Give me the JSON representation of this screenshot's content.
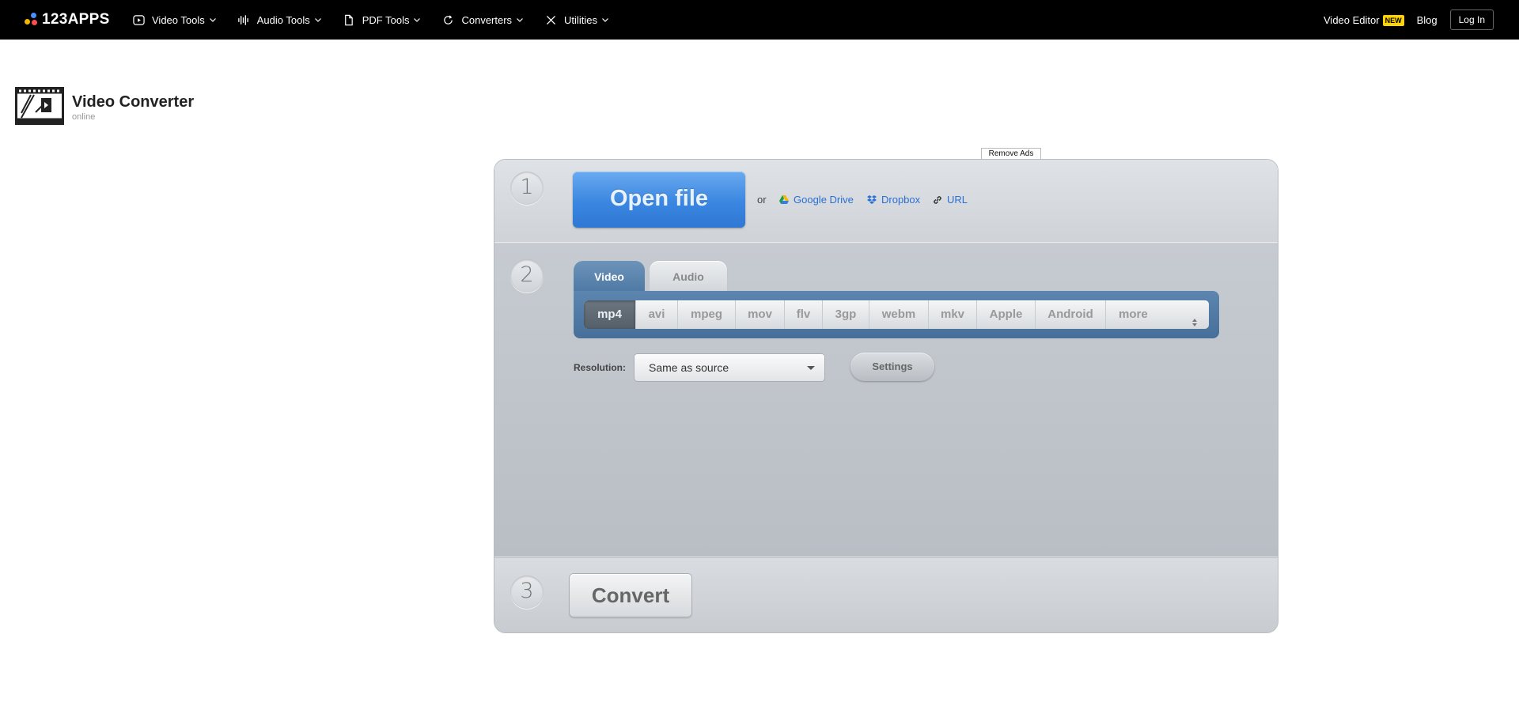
{
  "navbar": {
    "logo_text": "123APPS",
    "menu": [
      {
        "label": "Video Tools",
        "icon": "play-circle-icon"
      },
      {
        "label": "Audio Tools",
        "icon": "waveform-icon"
      },
      {
        "label": "PDF Tools",
        "icon": "document-icon"
      },
      {
        "label": "Converters",
        "icon": "refresh-icon"
      },
      {
        "label": "Utilities",
        "icon": "tools-icon"
      }
    ],
    "video_editor_label": "Video Editor",
    "new_badge": "NEW",
    "blog_label": "Blog",
    "login_label": "Log In"
  },
  "app": {
    "title": "Video Converter",
    "subtitle": "online",
    "remove_ads_label": "Remove Ads"
  },
  "step1": {
    "number": "1",
    "open_file_label": "Open file",
    "or_label": "or",
    "sources": [
      {
        "label": "Google Drive",
        "icon": "google-drive-icon"
      },
      {
        "label": "Dropbox",
        "icon": "dropbox-icon"
      },
      {
        "label": "URL",
        "icon": "link-icon"
      }
    ]
  },
  "step2": {
    "number": "2",
    "tabs": [
      {
        "label": "Video",
        "active": true
      },
      {
        "label": "Audio",
        "active": false
      }
    ],
    "formats": [
      "mp4",
      "avi",
      "mpeg",
      "mov",
      "flv",
      "3gp",
      "webm",
      "mkv",
      "Apple",
      "Android",
      "more"
    ],
    "active_format": "mp4",
    "resolution_label": "Resolution:",
    "resolution_value": "Same as source",
    "settings_label": "Settings"
  },
  "step3": {
    "number": "3",
    "convert_label": "Convert"
  },
  "colors": {
    "navbar_bg": "#000000",
    "open_file_blue": "#3a86e0",
    "link_blue": "#2a6fd1",
    "tab_active": "#4f7aa5",
    "new_badge": "#ffd400"
  }
}
